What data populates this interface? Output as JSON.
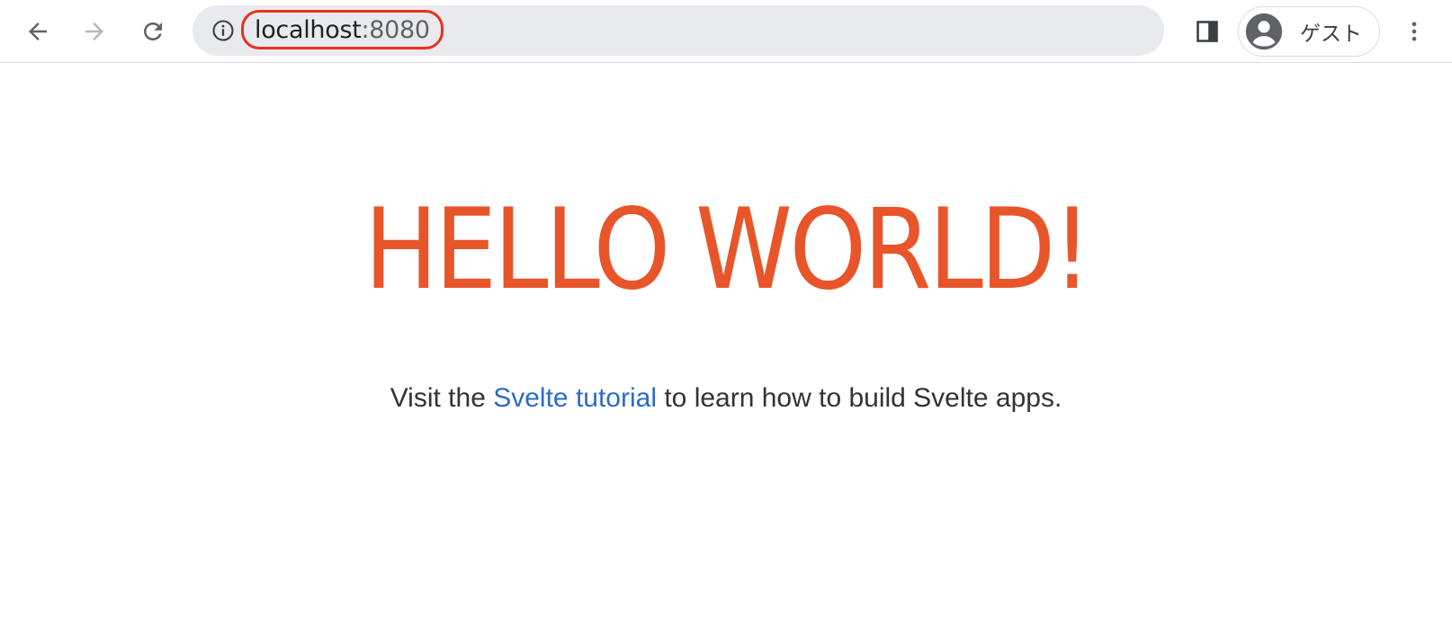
{
  "browser": {
    "url_host": "localhost",
    "url_port": ":8080",
    "profile_label": "ゲスト",
    "icons": {
      "back": "arrow-left-icon",
      "forward": "arrow-right-icon",
      "reload": "reload-icon",
      "info": "info-icon",
      "side_panel": "side-panel-icon",
      "avatar": "person-icon",
      "menu": "three-dots-vertical-icon"
    },
    "highlight_color": "#e8321f"
  },
  "page": {
    "heading": "HELLO WORLD!",
    "visit_prefix": "Visit the ",
    "visit_link": "Svelte tutorial",
    "visit_suffix": " to learn how to build Svelte apps.",
    "heading_color": "#e8552a",
    "link_color": "#2c6bc6"
  }
}
